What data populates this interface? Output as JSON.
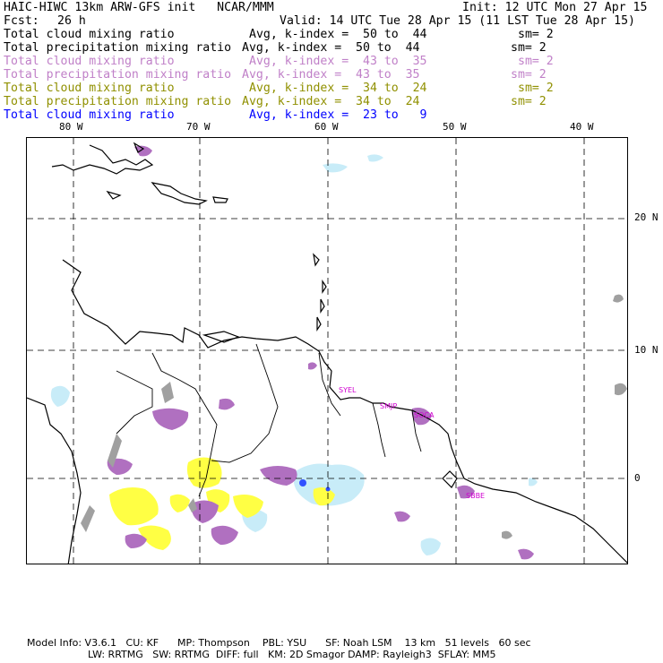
{
  "header": {
    "title": "HAIC-HIWC 13km ARW-GFS init   NCAR/MMM",
    "init": "Init: 12 UTC Mon 27 Apr 15",
    "fcst_label": "Fcst:",
    "fcst_value": "26 h",
    "valid": "Valid: 14 UTC Tue 28 Apr 15 (11 LST Tue 28 Apr 15)"
  },
  "legend": [
    {
      "field": "Total cloud mixing ratio",
      "range": "Avg, k-index =  50 to  44",
      "sm": "sm= 2",
      "color": "#000000"
    },
    {
      "field": "Total precipitation mixing ratio",
      "range": "Avg, k-index =  50 to  44",
      "sm": "sm= 2",
      "color": "#000000"
    },
    {
      "field": "Total cloud mixing ratio",
      "range": "Avg, k-index =  43 to  35",
      "sm": "sm= 2",
      "color": "#c080c8"
    },
    {
      "field": "Total precipitation mixing ratio",
      "range": "Avg, k-index =  43 to  35",
      "sm": "sm= 2",
      "color": "#c080c8"
    },
    {
      "field": "Total cloud mixing ratio",
      "range": "Avg, k-index =  34 to  24",
      "sm": "sm= 2",
      "color": "#909000"
    },
    {
      "field": "Total precipitation mixing ratio",
      "range": "Avg, k-index =  34 to  24",
      "sm": "sm= 2",
      "color": "#909000"
    },
    {
      "field": "Total cloud mixing ratio",
      "range": "Avg, k-index =  23 to   9",
      "sm": "",
      "color": "#0000ff"
    }
  ],
  "map": {
    "lon_labels": [
      "80 W",
      "70 W",
      "60 W",
      "50 W",
      "40 W"
    ],
    "lat_labels": [
      "20 N",
      "10 N",
      "0"
    ],
    "stations": [
      "SYEL",
      "SMJP",
      "SOCA",
      "SBBE"
    ],
    "colors": {
      "coast": "#000000",
      "grid": "#000000",
      "upper_level": "#a0a0a0",
      "mid_level": "#b070c0",
      "low_level": "#ffff44",
      "shallow_cloud": "#c8ecf8",
      "core": "#3050ff"
    }
  },
  "footer": {
    "line1": "Model Info: V3.6.1   CU: KF      MP: Thompson    PBL: YSU      SF: Noah LSM    13 km   51 levels   60 sec",
    "line2": "LW: RRTMG   SW: RRTMG  DIFF: full   KM: 2D Smagor DAMP: Rayleigh3  SFLAY: MM5"
  }
}
